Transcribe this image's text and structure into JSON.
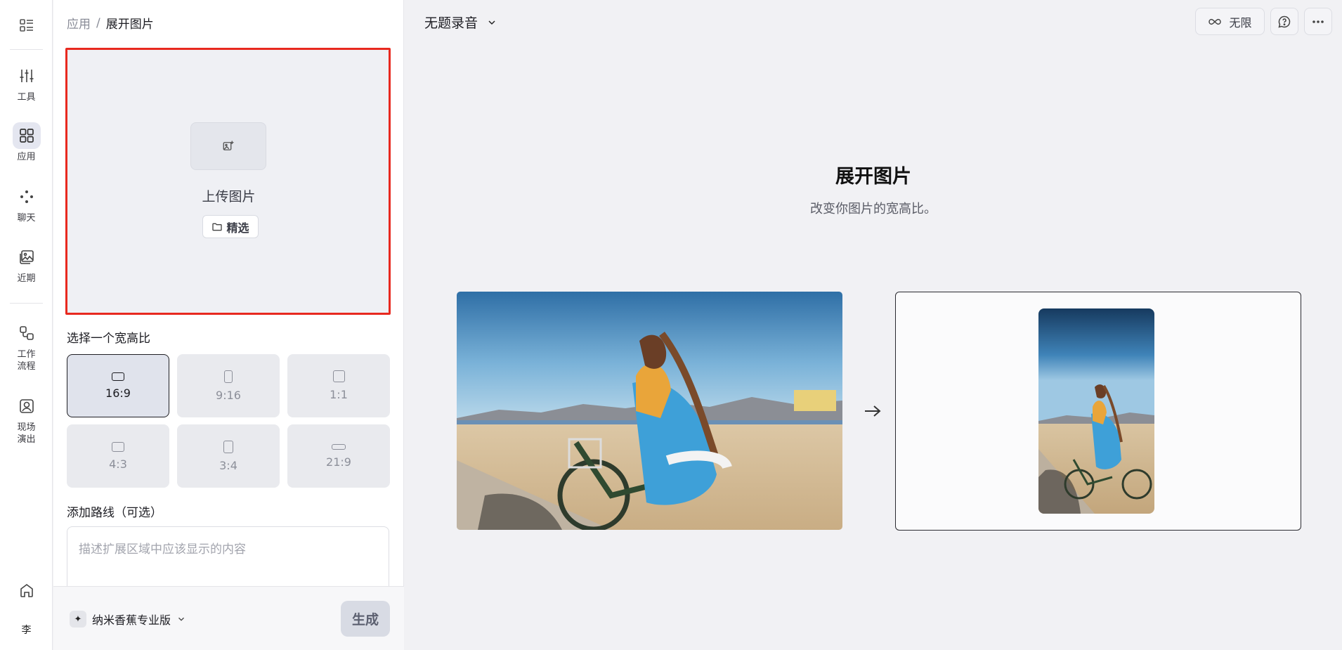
{
  "rail": {
    "items": [
      {
        "label": "工具",
        "icon": "sliders-icon"
      },
      {
        "label": "应用",
        "icon": "apps-grid-icon"
      },
      {
        "label": "聊天",
        "icon": "chat-dots-icon"
      },
      {
        "label": "近期",
        "icon": "recent-images-icon"
      },
      {
        "label": "工作\n流程",
        "label_line1": "工作",
        "label_line2": "流程",
        "icon": "workflow-icon"
      },
      {
        "label_line1": "现场",
        "label_line2": "演出",
        "icon": "live-portrait-icon"
      }
    ],
    "avatar": "李"
  },
  "panel": {
    "breadcrumb": {
      "parent": "应用",
      "separator": "/",
      "current": "展开图片"
    },
    "upload": {
      "label": "上传图片",
      "featured_label": "精选"
    },
    "aspect_title": "选择一个宽高比",
    "ratios": [
      {
        "label": "16:9",
        "selected": true
      },
      {
        "label": "9:16",
        "selected": false
      },
      {
        "label": "1:1",
        "selected": false
      },
      {
        "label": "4:3",
        "selected": false
      },
      {
        "label": "3:4",
        "selected": false
      },
      {
        "label": "21:9",
        "selected": false
      }
    ],
    "route_title": "添加路线（可选）",
    "prompt_placeholder": "描述扩展区域中应该显示的内容",
    "model_name": "纳米香蕉专业版",
    "generate_label": "生成"
  },
  "main": {
    "doc_title": "无题录音",
    "unlimited_label": "无限",
    "hero_title": "展开图片",
    "hero_subtitle": "改变你图片的宽高比。"
  },
  "colors": {
    "accent_outline": "#e8291f",
    "selected_border": "#1f1f24"
  }
}
